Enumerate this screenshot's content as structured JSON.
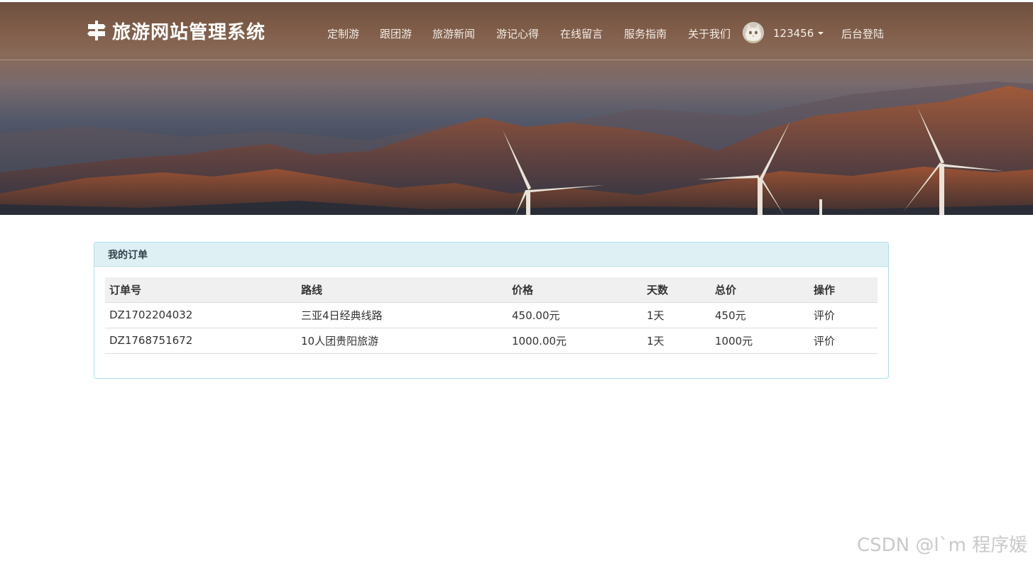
{
  "header": {
    "brand": "旅游网站管理系统",
    "brand_icon": "signpost-icon",
    "nav": [
      "定制游",
      "跟团游",
      "旅游新闻",
      "游记心得",
      "在线留言",
      "服务指南",
      "关于我们"
    ],
    "user": {
      "name": "123456",
      "avatar_icon": "cat-avatar-icon"
    },
    "admin_login": "后台登陆"
  },
  "orders": {
    "title": "我的订单",
    "columns": [
      "订单号",
      "路线",
      "价格",
      "天数",
      "总价",
      "操作"
    ],
    "rows": [
      {
        "id": "DZ1702204032",
        "route": "三亚4日经典线路",
        "price": "450.00元",
        "days": "1天",
        "total": "450元",
        "action": "评价"
      },
      {
        "id": "DZ1768751672",
        "route": "10人团贵阳旅游",
        "price": "1000.00元",
        "days": "1天",
        "total": "1000元",
        "action": "评价"
      }
    ]
  },
  "watermark": "CSDN @l`m 程序媛",
  "colors": {
    "header_brown": "#7a5a48",
    "panel_border": "#a9dfe6",
    "panel_heading_bg": "#dff0f5"
  }
}
